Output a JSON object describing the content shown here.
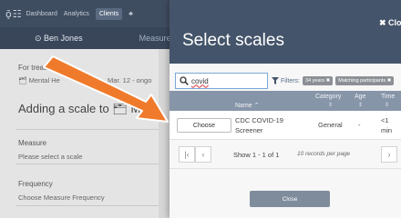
{
  "app": {
    "logo": "ǭ☷",
    "nav": [
      {
        "label": "Dashboard"
      },
      {
        "label": "Analytics"
      },
      {
        "label": "Clients"
      },
      {
        "label": "♣"
      }
    ],
    "person": "⊙ Ben Jones",
    "measures_tab": "Measurem",
    "treatment_label": "For treatm",
    "treatment_value": "🗂 Mental He",
    "treatment_dates": "Mar. 12 - ongo",
    "adding_heading": "Adding a scale to 🗂 Menta",
    "measure_label": "Measure",
    "measure_placeholder": "Please select a scale",
    "frequency_label": "Frequency",
    "frequency_placeholder": "Choose Measure Frequency"
  },
  "modal": {
    "title": "Select scales",
    "close_top": "✖ Clo",
    "search_value": "covid",
    "filters_label": "Filters:",
    "chips": [
      "34 years ✖",
      "Matching participants ✖"
    ],
    "columns": {
      "name": "Name ⌃",
      "category": "Category",
      "age": "Age",
      "time": "Time"
    },
    "row": {
      "choose": "Choose",
      "name_line1": "CDC COVID-19",
      "name_line2": "Screener",
      "category": "General",
      "age": "-",
      "time_line1": "<1",
      "time_line2": "min"
    },
    "pager": {
      "first": "|‹",
      "prev": "‹",
      "next": "›",
      "status": "Show 1 - 1 of 1",
      "records": "10 records per page"
    },
    "close_bottom": "Close"
  },
  "colors": {
    "arrow": "#f07a2b",
    "header": "#44546a",
    "table_header": "#8795a8"
  }
}
